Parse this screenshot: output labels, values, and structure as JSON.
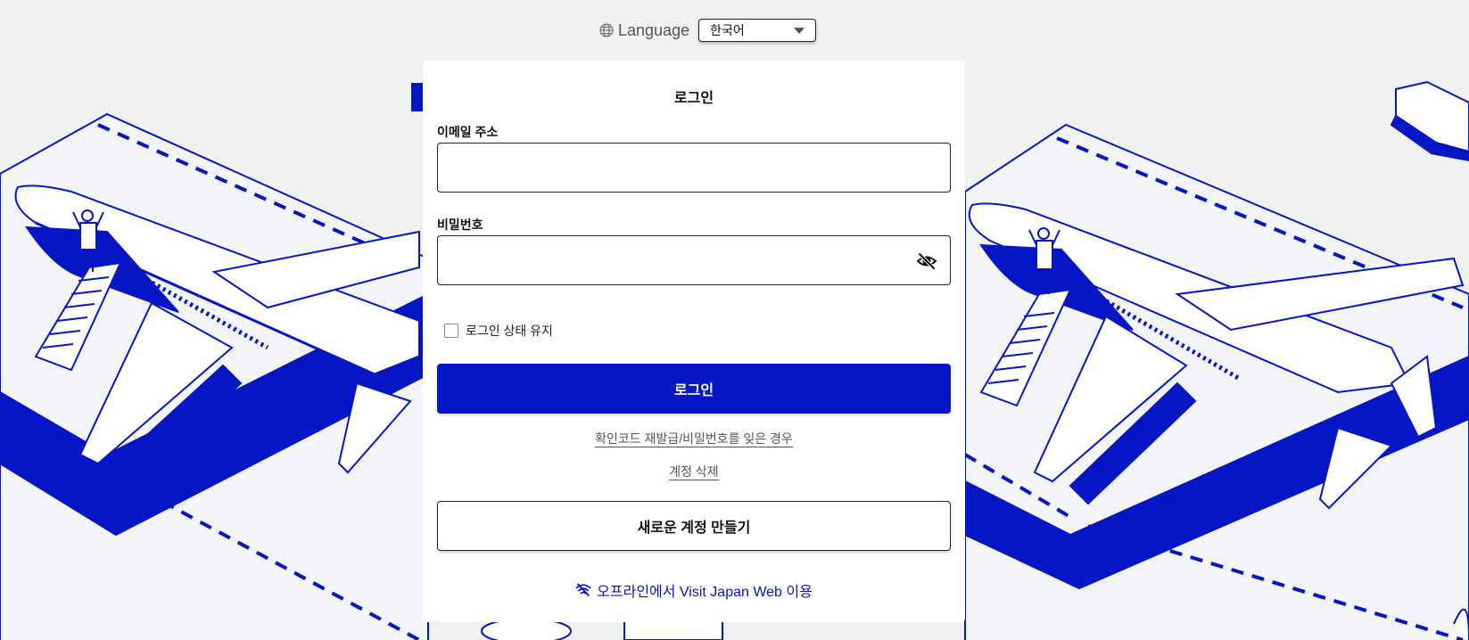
{
  "language": {
    "label": "Language",
    "selected": "한국어",
    "icon": "globe-icon"
  },
  "login": {
    "title": "로그인",
    "email_label": "이메일 주소",
    "email_value": "",
    "password_label": "비밀번호",
    "password_value": "",
    "password_toggle_icon": "eye-slash-icon",
    "keep_logged_in_label": "로그인 상태 유지",
    "keep_logged_in_checked": false,
    "submit_label": "로그인",
    "forgot_link": "확인코드 재발급/비밀번호를 잊은 경우",
    "delete_account_link": "계정 삭제",
    "create_account_label": "새로운 계정 만들기",
    "offline_link": "오프라인에서 Visit Japan Web 이용",
    "offline_icon": "wifi-off-icon"
  },
  "colors": {
    "brand_blue": "#0516c5",
    "background": "#f0f1f3",
    "card": "#ffffff"
  }
}
